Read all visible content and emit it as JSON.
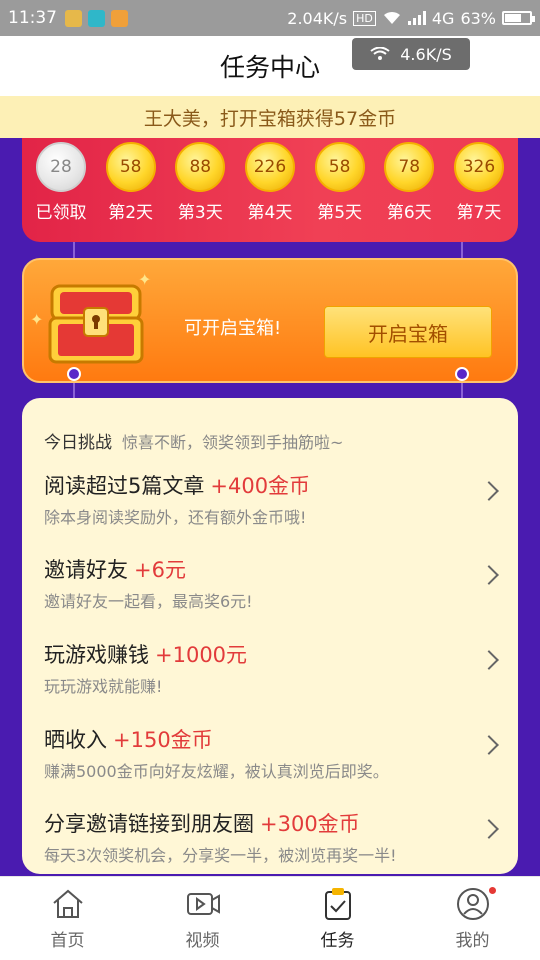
{
  "status": {
    "time": "11:37",
    "speed": "2.04K/s",
    "hd": "HD",
    "net": "4G",
    "battery": "63%",
    "battery_level": 0.63
  },
  "header": {
    "title": "任务中心",
    "wifi_speed": "4.6K/S"
  },
  "notice": "王大美，打开宝箱获得57金币",
  "signin": {
    "days": [
      {
        "value": "28",
        "label": "已领取",
        "done": true
      },
      {
        "value": "58",
        "label": "第2天"
      },
      {
        "value": "88",
        "label": "第3天"
      },
      {
        "value": "226",
        "label": "第4天"
      },
      {
        "value": "58",
        "label": "第5天"
      },
      {
        "value": "78",
        "label": "第6天"
      },
      {
        "value": "326",
        "label": "第7天"
      }
    ]
  },
  "chest": {
    "text": "可开启宝箱!",
    "button": "开启宝箱"
  },
  "tasks": {
    "title": "今日挑战",
    "subtitle": "惊喜不断，领奖领到手抽筋啦~",
    "items": [
      {
        "title": "阅读超过5篇文章",
        "reward": "+400金币",
        "desc": "除本身阅读奖励外，还有额外金币哦!"
      },
      {
        "title": "邀请好友",
        "reward": "+6元",
        "desc": "邀请好友一起看，最高奖6元!"
      },
      {
        "title": "玩游戏赚钱",
        "reward": "+1000元",
        "desc": "玩玩游戏就能赚!"
      },
      {
        "title": "晒收入",
        "reward": "+150金币",
        "desc": "赚满5000金币向好友炫耀，被认真浏览后即奖。"
      },
      {
        "title": "分享邀请链接到朋友圈",
        "reward": "+300金币",
        "desc": "每天3次领奖机会，分享奖一半，被浏览再奖一半!"
      }
    ]
  },
  "tabbar": {
    "items": [
      {
        "label": "首页",
        "icon": "home-icon"
      },
      {
        "label": "视频",
        "icon": "video-icon"
      },
      {
        "label": "任务",
        "icon": "task-icon"
      },
      {
        "label": "我的",
        "icon": "profile-icon"
      }
    ]
  },
  "colors": {
    "purple": "#4a1bb0",
    "red": "#e22447",
    "orange": "#ff7a10",
    "reward_red": "#e23b3b"
  }
}
